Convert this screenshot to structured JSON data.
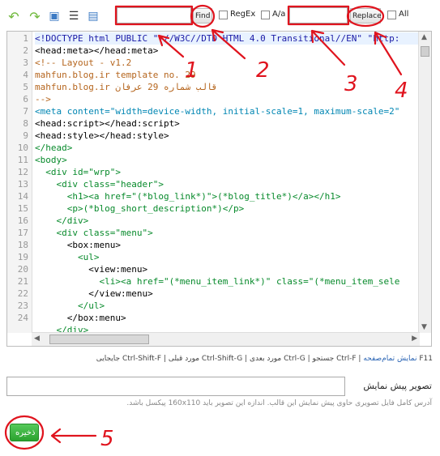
{
  "toolbar": {
    "find_value": "",
    "find_label": "Find",
    "regex_label": "RegEx",
    "case_label": "A/a",
    "replace_value": "",
    "replace_label": "Replace",
    "all_label": "All"
  },
  "editor": {
    "line_numbers": [
      "1",
      "2",
      "3",
      "4",
      "5",
      "6",
      "7",
      "8",
      "9",
      "10",
      "11",
      "12",
      "13",
      "14",
      "15",
      "16",
      "17",
      "18",
      "19",
      "20",
      "21",
      "22",
      "23",
      "24"
    ]
  },
  "code_lines": [
    "<!DOCTYPE html PUBLIC \"-//W3C//DTD HTML 4.0 Transitional//EN\" \"http:",
    "<head:meta></head:meta>",
    "<!-- Layout - v1.2",
    "mahfun.blog.ir template no. 29",
    "mahfun.blog.ir قالب شماره 29 عرفان",
    "-->",
    "<meta content=\"width=device-width, initial-scale=1, maximum-scale=2\"",
    "<head:script></head:script>",
    "<head:style></head:style>",
    "</head>",
    "<body>",
    "  <div id=\"wrp\">",
    "    <div class=\"header\">",
    "      <h1><a href=\"(*blog_link*)\">(*blog_title*)</a></h1>",
    "      <p>(*blog_short_description*)</p>",
    "    </div>",
    "    <div class=\"menu\">",
    "      <box:menu>",
    "        <ul>",
    "          <view:menu>",
    "            <li><a href=\"(*menu_item_link*)\" class=\"(*menu_item_sele",
    "          </view:menu>",
    "        </ul>",
    "      </box:menu>",
    "    </div>"
  ],
  "hint": {
    "f11": "F11",
    "fullscreen": "نمایش تمام‌صفحه",
    "rest": "| Ctrl-F جستجو | Ctrl-G مورد بعدی | Ctrl-Shift-G مورد قبلی | Ctrl-Shift-F جایجایی"
  },
  "preview": {
    "label": "تصویر پیش نمایش",
    "value": "",
    "note": "آدرس کامل فایل تصویری حاوی پیش نمایش این قالب. اندازه این تصویر باید 160x110 پیکسل باشد."
  },
  "save_label": "ذخیره",
  "annotations": [
    "1",
    "2",
    "3",
    "4",
    "5"
  ],
  "colors": {
    "annotation_red": "#e0141e",
    "save_green": "#2ba22f",
    "link_blue": "#2a64b4"
  }
}
